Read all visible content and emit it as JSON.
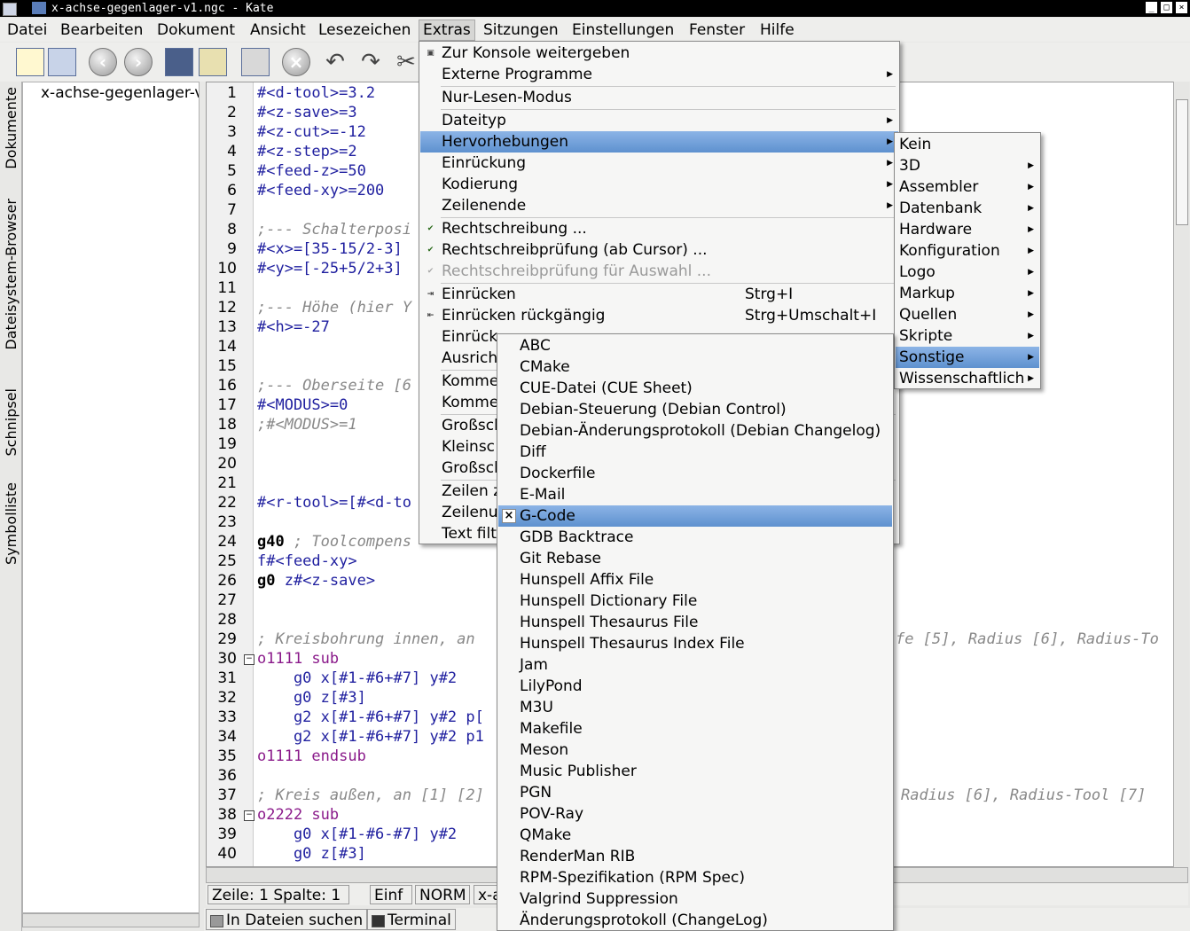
{
  "window": {
    "title": "x-achse-gegenlager-v1.ngc - Kate"
  },
  "menubar": [
    "Datei",
    "Bearbeiten",
    "Dokument",
    "Ansicht",
    "Lesezeichen",
    "Extras",
    "Sitzungen",
    "Einstellungen",
    "Fenster",
    "Hilfe"
  ],
  "sidebar": {
    "tabs": [
      "Dokumente",
      "Dateisystem-Browser",
      "Schnipsel",
      "Symbolliste"
    ],
    "document": "x-achse-gegenlager-v"
  },
  "editor": {
    "line_numbers": [
      "1",
      "2",
      "3",
      "4",
      "5",
      "6",
      "7",
      "8",
      "9",
      "10",
      "11",
      "12",
      "13",
      "14",
      "15",
      "16",
      "17",
      "18",
      "19",
      "20",
      "21",
      "22",
      "23",
      "24",
      "25",
      "26",
      "27",
      "28",
      "29",
      "30",
      "31",
      "32",
      "33",
      "34",
      "35",
      "36",
      "37",
      "38",
      "39",
      "40"
    ],
    "lines": {
      "l1": "#<d-tool>=3.2",
      "l2": "#<z-save>=3",
      "l3": "#<z-cut>=-12",
      "l4": "#<z-step>=2",
      "l5": "#<feed-z>=50",
      "l6": "#<feed-xy>=200",
      "l8": ";--- Schalterposi",
      "l9": "#<x>=[35-15/2-3]",
      "l10": "#<y>=[-25+5/2+3]",
      "l12": ";--- Höhe (hier Y",
      "l13": "#<h>=-27",
      "l16": ";--- Oberseite [6",
      "l17": "#<MODUS>=0",
      "l18": ";#<MODUS>=1",
      "l22": "#<r-tool>=[#<d-to",
      "l24a": "g40",
      "l24b": " ; Toolcompens",
      "l25": "f#<feed-xy>",
      "l26a": "g0",
      "l26b": " z#<z-save>",
      "l29a": "; Kreisbohrung innen, an",
      "l29b": "fe [5], Radius [6], Radius-To",
      "l30a": "o1111",
      "l30b": " sub",
      "l31": "    g0 x[#1-#6+#7] y#2",
      "l32": "    g0 z[#3]",
      "l33": "    g2 x[#1-#6+#7] y#2 p[",
      "l34": "    g2 x[#1-#6+#7] y#2 p1",
      "l35a": "o1111",
      "l35b": " endsub",
      "l37a": "; Kreis außen, an [1] [2]",
      "l37b": "Radius [6], Radius-Tool [7]",
      "l38a": "o2222",
      "l38b": " sub",
      "l39": "    g0 x[#1-#6-#7] y#2",
      "l40": "    g0 z[#3]"
    }
  },
  "statusbar": {
    "position": "Zeile: 1 Spalte: 1",
    "mode_ins": "Einf",
    "mode_norm": "NORM",
    "file": "x-a"
  },
  "bottom_tabs": [
    "In Dateien suchen",
    "Terminal"
  ],
  "extras_menu": [
    {
      "label": "Zur Konsole weitergeben",
      "icon": "console-icon"
    },
    {
      "label": "Externe Programme",
      "submenu": true
    },
    {
      "label": "Nur-Lesen-Modus"
    },
    {
      "label": "Dateityp",
      "submenu": true
    },
    {
      "label": "Hervorhebungen",
      "submenu": true,
      "highlighted": true
    },
    {
      "label": "Einrückung",
      "submenu": true
    },
    {
      "label": "Kodierung",
      "submenu": true
    },
    {
      "label": "Zeilenende",
      "submenu": true
    },
    {
      "label": "Rechtschreibung ...",
      "icon": "spellcheck-icon"
    },
    {
      "label": "Rechtschreibprüfung (ab Cursor) ...",
      "icon": "spellcheck-icon"
    },
    {
      "label": "Rechtschreibprüfung für Auswahl ...",
      "icon": "spellcheck-icon",
      "disabled": true
    },
    {
      "label": "Einrücken",
      "shortcut": "Strg+I",
      "icon": "indent-icon"
    },
    {
      "label": "Einrücken rückgängig",
      "shortcut": "Strg+Umschalt+I",
      "icon": "unindent-icon"
    },
    {
      "label": "Einrück"
    },
    {
      "label": "Ausricht"
    },
    {
      "label": "Komme"
    },
    {
      "label": "Komme"
    },
    {
      "label": "Großsch"
    },
    {
      "label": "Kleinsc"
    },
    {
      "label": "Großsch"
    },
    {
      "label": "Zeilen z"
    },
    {
      "label": "Zeilenu"
    },
    {
      "label": "Text filt"
    }
  ],
  "highlight_menu": [
    {
      "label": "Kein"
    },
    {
      "label": "3D",
      "submenu": true
    },
    {
      "label": "Assembler",
      "submenu": true
    },
    {
      "label": "Datenbank",
      "submenu": true
    },
    {
      "label": "Hardware",
      "submenu": true
    },
    {
      "label": "Konfiguration",
      "submenu": true
    },
    {
      "label": "Logo",
      "submenu": true
    },
    {
      "label": "Markup",
      "submenu": true
    },
    {
      "label": "Quellen",
      "submenu": true
    },
    {
      "label": "Skripte",
      "submenu": true
    },
    {
      "label": "Sonstige",
      "submenu": true,
      "highlighted": true
    },
    {
      "label": "Wissenschaftlich",
      "submenu": true
    }
  ],
  "other_menu": [
    {
      "label": "ABC"
    },
    {
      "label": "CMake"
    },
    {
      "label": "CUE-Datei (CUE Sheet)"
    },
    {
      "label": "Debian-Steuerung (Debian Control)"
    },
    {
      "label": "Debian-Änderungsprotokoll (Debian Changelog)"
    },
    {
      "label": "Diff"
    },
    {
      "label": "Dockerfile"
    },
    {
      "label": "E-Mail"
    },
    {
      "label": "G-Code",
      "checked": true,
      "highlighted": true
    },
    {
      "label": "GDB Backtrace"
    },
    {
      "label": "Git Rebase"
    },
    {
      "label": "Hunspell Affix File"
    },
    {
      "label": "Hunspell Dictionary File"
    },
    {
      "label": "Hunspell Thesaurus File"
    },
    {
      "label": "Hunspell Thesaurus Index File"
    },
    {
      "label": "Jam"
    },
    {
      "label": "LilyPond"
    },
    {
      "label": "M3U"
    },
    {
      "label": "Makefile"
    },
    {
      "label": "Meson"
    },
    {
      "label": "Music Publisher"
    },
    {
      "label": "PGN"
    },
    {
      "label": "POV-Ray"
    },
    {
      "label": "QMake"
    },
    {
      "label": "RenderMan RIB"
    },
    {
      "label": "RPM-Spezifikation (RPM Spec)"
    },
    {
      "label": "Valgrind Suppression"
    },
    {
      "label": "Änderungsprotokoll (ChangeLog)"
    }
  ],
  "colors": {
    "menu_highlight": "#6e9fd6",
    "keyword_number": "#a03a00",
    "variable": "#1f1f9f"
  }
}
